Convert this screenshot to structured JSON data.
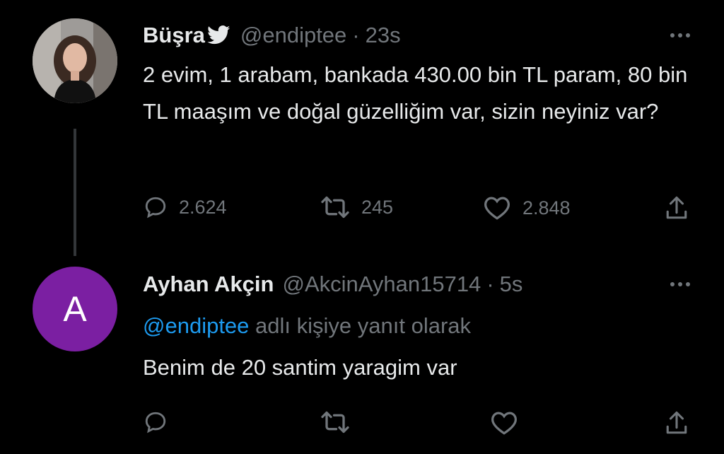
{
  "tweet1": {
    "name": "Büşra",
    "handle": "@endiptee",
    "separator": "·",
    "time": "23s",
    "text": "2 evim, 1 arabam, bankada 430.00 bin TL param, 80 bin TL maaşım ve doğal güzelliğim var, sizin neyiniz var?",
    "replies": "2.624",
    "retweets": "245",
    "likes": "2.848"
  },
  "tweet2": {
    "name": "Ayhan Akçin",
    "handle": "@AkcinAyhan15714",
    "separator": "·",
    "time": "5s",
    "avatar_letter": "A",
    "avatar_color": "#7b1fa2",
    "reply_to": "@endiptee",
    "reply_suffix": " adlı kişiye yanıt olarak",
    "text": "Benim de 20 santim yaragim var"
  },
  "icons": {
    "reply": "reply-icon",
    "retweet": "retweet-icon",
    "like": "heart-icon",
    "share": "share-icon",
    "more": "more-icon",
    "verified": "bird-badge-icon"
  },
  "colors": {
    "background": "#000000",
    "text": "#e7e9ea",
    "muted": "#71767b",
    "link": "#1d9bf0"
  }
}
